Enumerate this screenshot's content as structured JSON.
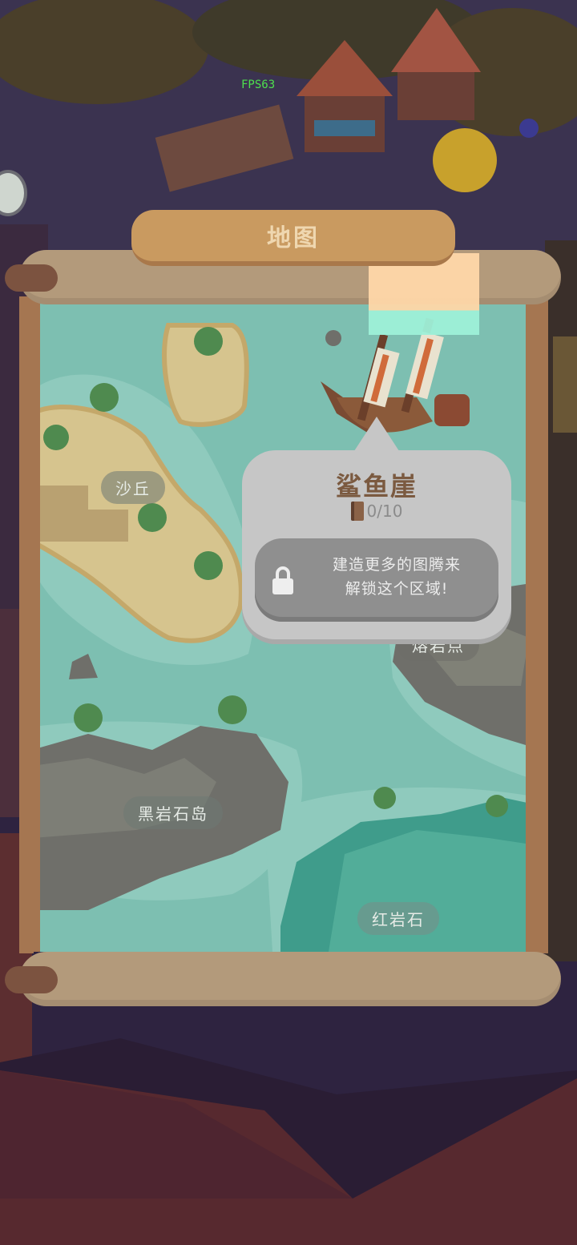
{
  "hud": {
    "fps": "FPS63"
  },
  "map_panel": {
    "title": "地图",
    "regions": [
      {
        "name": "沙丘"
      },
      {
        "name": "熔岩点"
      },
      {
        "name": "黑岩石岛"
      },
      {
        "name": "红岩石"
      }
    ]
  },
  "popup": {
    "title": "鲨鱼崖",
    "progress": "0/10",
    "lock_line1": "建造更多的图腾来",
    "lock_line2": "解锁这个区域!"
  },
  "colors": {
    "sea": "#7dbfb1",
    "sand": "#d6c48e",
    "rock": "#6f6f6a",
    "scroll": "#b39a7b",
    "popup": "#c6c6c6"
  },
  "icons": [
    "compass-icon",
    "book-icon",
    "lock-icon",
    "palm-tree-icon",
    "ship-icon"
  ]
}
